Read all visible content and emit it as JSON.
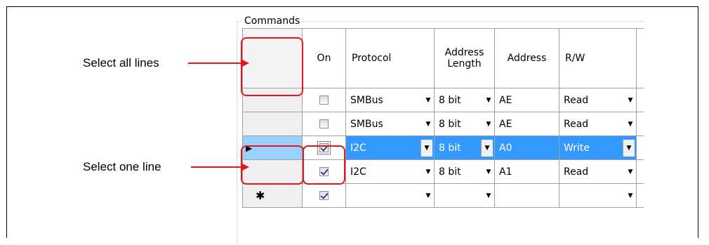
{
  "groupbox": {
    "title": "Commands"
  },
  "annotations": {
    "select_all": "Select all lines",
    "select_one": "Select one line"
  },
  "columns": {
    "on": "On",
    "protocol": "Protocol",
    "address_length": "Address Length",
    "address": "Address",
    "rw": "R/W"
  },
  "rows": [
    {
      "on": false,
      "protocol": "SMBus",
      "length": "8 bit",
      "address": "AE",
      "rw": "Read"
    },
    {
      "on": false,
      "protocol": "SMBus",
      "length": "8 bit",
      "address": "AE",
      "rw": "Read"
    },
    {
      "on": true,
      "protocol": "I2C",
      "length": "8 bit",
      "address": "A0",
      "rw": "Write"
    },
    {
      "on": true,
      "protocol": "I2C",
      "length": "8 bit",
      "address": "A1",
      "rw": "Read"
    }
  ],
  "new_row": {
    "marker": "✱",
    "on": true
  },
  "selected_row_marker": "▶",
  "colors": {
    "selection": "#3399ff",
    "row_header_selected": "#99d1ff",
    "annotation": "#e8151b"
  }
}
